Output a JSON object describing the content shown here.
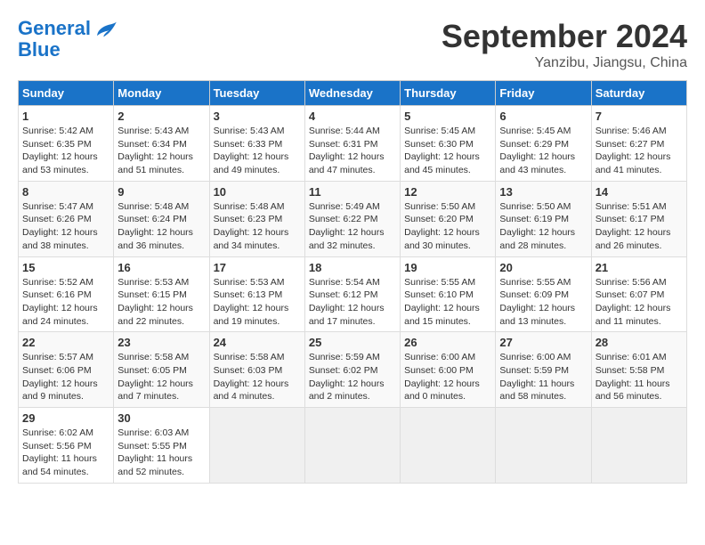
{
  "header": {
    "logo_line1": "General",
    "logo_line2": "Blue",
    "month": "September 2024",
    "location": "Yanzibu, Jiangsu, China"
  },
  "days_of_week": [
    "Sunday",
    "Monday",
    "Tuesday",
    "Wednesday",
    "Thursday",
    "Friday",
    "Saturday"
  ],
  "weeks": [
    [
      {
        "day": 1,
        "sunrise": "5:42 AM",
        "sunset": "6:35 PM",
        "daylight": "12 hours and 53 minutes."
      },
      {
        "day": 2,
        "sunrise": "5:43 AM",
        "sunset": "6:34 PM",
        "daylight": "12 hours and 51 minutes."
      },
      {
        "day": 3,
        "sunrise": "5:43 AM",
        "sunset": "6:33 PM",
        "daylight": "12 hours and 49 minutes."
      },
      {
        "day": 4,
        "sunrise": "5:44 AM",
        "sunset": "6:31 PM",
        "daylight": "12 hours and 47 minutes."
      },
      {
        "day": 5,
        "sunrise": "5:45 AM",
        "sunset": "6:30 PM",
        "daylight": "12 hours and 45 minutes."
      },
      {
        "day": 6,
        "sunrise": "5:45 AM",
        "sunset": "6:29 PM",
        "daylight": "12 hours and 43 minutes."
      },
      {
        "day": 7,
        "sunrise": "5:46 AM",
        "sunset": "6:27 PM",
        "daylight": "12 hours and 41 minutes."
      }
    ],
    [
      {
        "day": 8,
        "sunrise": "5:47 AM",
        "sunset": "6:26 PM",
        "daylight": "12 hours and 38 minutes."
      },
      {
        "day": 9,
        "sunrise": "5:48 AM",
        "sunset": "6:24 PM",
        "daylight": "12 hours and 36 minutes."
      },
      {
        "day": 10,
        "sunrise": "5:48 AM",
        "sunset": "6:23 PM",
        "daylight": "12 hours and 34 minutes."
      },
      {
        "day": 11,
        "sunrise": "5:49 AM",
        "sunset": "6:22 PM",
        "daylight": "12 hours and 32 minutes."
      },
      {
        "day": 12,
        "sunrise": "5:50 AM",
        "sunset": "6:20 PM",
        "daylight": "12 hours and 30 minutes."
      },
      {
        "day": 13,
        "sunrise": "5:50 AM",
        "sunset": "6:19 PM",
        "daylight": "12 hours and 28 minutes."
      },
      {
        "day": 14,
        "sunrise": "5:51 AM",
        "sunset": "6:17 PM",
        "daylight": "12 hours and 26 minutes."
      }
    ],
    [
      {
        "day": 15,
        "sunrise": "5:52 AM",
        "sunset": "6:16 PM",
        "daylight": "12 hours and 24 minutes."
      },
      {
        "day": 16,
        "sunrise": "5:53 AM",
        "sunset": "6:15 PM",
        "daylight": "12 hours and 22 minutes."
      },
      {
        "day": 17,
        "sunrise": "5:53 AM",
        "sunset": "6:13 PM",
        "daylight": "12 hours and 19 minutes."
      },
      {
        "day": 18,
        "sunrise": "5:54 AM",
        "sunset": "6:12 PM",
        "daylight": "12 hours and 17 minutes."
      },
      {
        "day": 19,
        "sunrise": "5:55 AM",
        "sunset": "6:10 PM",
        "daylight": "12 hours and 15 minutes."
      },
      {
        "day": 20,
        "sunrise": "5:55 AM",
        "sunset": "6:09 PM",
        "daylight": "12 hours and 13 minutes."
      },
      {
        "day": 21,
        "sunrise": "5:56 AM",
        "sunset": "6:07 PM",
        "daylight": "12 hours and 11 minutes."
      }
    ],
    [
      {
        "day": 22,
        "sunrise": "5:57 AM",
        "sunset": "6:06 PM",
        "daylight": "12 hours and 9 minutes."
      },
      {
        "day": 23,
        "sunrise": "5:58 AM",
        "sunset": "6:05 PM",
        "daylight": "12 hours and 7 minutes."
      },
      {
        "day": 24,
        "sunrise": "5:58 AM",
        "sunset": "6:03 PM",
        "daylight": "12 hours and 4 minutes."
      },
      {
        "day": 25,
        "sunrise": "5:59 AM",
        "sunset": "6:02 PM",
        "daylight": "12 hours and 2 minutes."
      },
      {
        "day": 26,
        "sunrise": "6:00 AM",
        "sunset": "6:00 PM",
        "daylight": "12 hours and 0 minutes."
      },
      {
        "day": 27,
        "sunrise": "6:00 AM",
        "sunset": "5:59 PM",
        "daylight": "11 hours and 58 minutes."
      },
      {
        "day": 28,
        "sunrise": "6:01 AM",
        "sunset": "5:58 PM",
        "daylight": "11 hours and 56 minutes."
      }
    ],
    [
      {
        "day": 29,
        "sunrise": "6:02 AM",
        "sunset": "5:56 PM",
        "daylight": "11 hours and 54 minutes."
      },
      {
        "day": 30,
        "sunrise": "6:03 AM",
        "sunset": "5:55 PM",
        "daylight": "11 hours and 52 minutes."
      },
      null,
      null,
      null,
      null,
      null
    ]
  ]
}
